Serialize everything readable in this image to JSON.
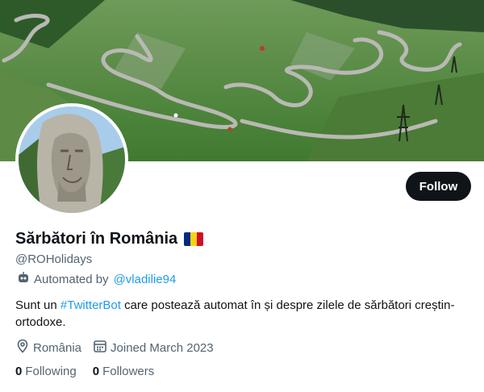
{
  "profile": {
    "display_name": "Sărbători în România",
    "handle": "@ROHolidays",
    "automated_prefix": "Automated by",
    "automated_link": "@vladilie94",
    "bio_before": "Sunt un ",
    "bio_hashtag": "#TwitterBot",
    "bio_after": " care postează automat în și despre zilele de sărbători creștin-ortodoxe.",
    "location": "România",
    "joined": "Joined March 2023",
    "following_count": "0",
    "following_label": "Following",
    "followers_count": "0",
    "followers_label": "Followers"
  },
  "actions": {
    "follow_label": "Follow"
  },
  "icons": {
    "flag": "romania-flag-icon",
    "automated": "bot-icon",
    "location": "location-pin-icon",
    "joined": "calendar-icon"
  },
  "colors": {
    "accent": "#1d9bf0",
    "text": "#0f1419",
    "secondary": "#536471",
    "button": "#0f1419",
    "flag_blue": "#002B7F",
    "flag_yellow": "#FCD116",
    "flag_red": "#CE1126"
  }
}
